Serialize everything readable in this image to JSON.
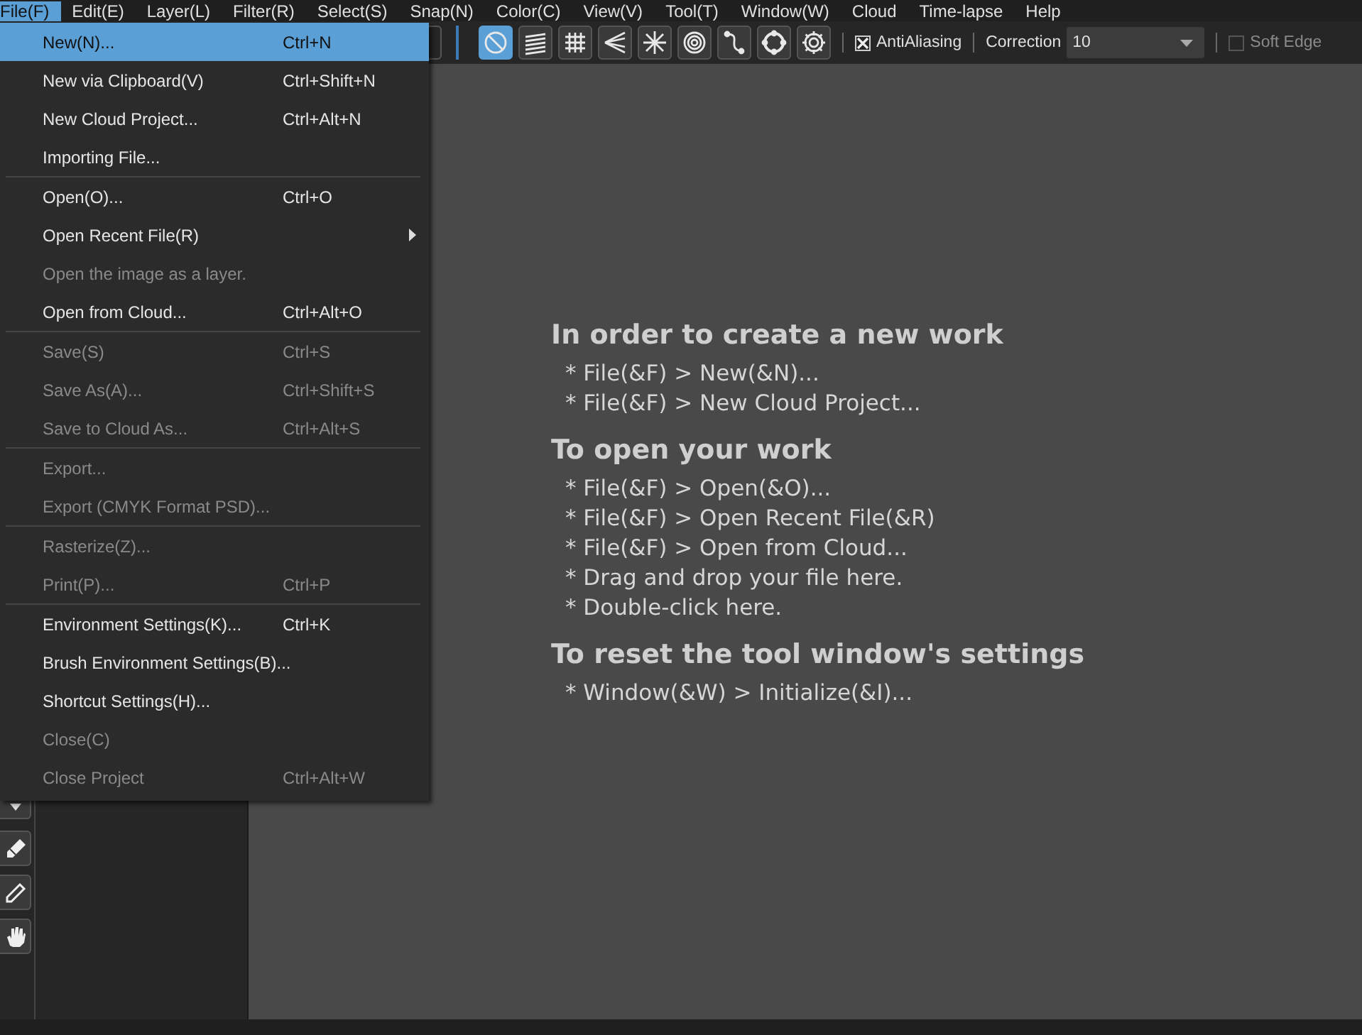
{
  "menubar": [
    {
      "label": "File(F)",
      "selected": true
    },
    {
      "label": "Edit(E)",
      "selected": false
    },
    {
      "label": "Layer(L)",
      "selected": false
    },
    {
      "label": "Filter(R)",
      "selected": false
    },
    {
      "label": "Select(S)",
      "selected": false
    },
    {
      "label": "Snap(N)",
      "selected": false
    },
    {
      "label": "Color(C)",
      "selected": false
    },
    {
      "label": "View(V)",
      "selected": false
    },
    {
      "label": "Tool(T)",
      "selected": false
    },
    {
      "label": "Window(W)",
      "selected": false
    },
    {
      "label": "Cloud",
      "selected": false
    },
    {
      "label": "Time-lapse",
      "selected": false
    },
    {
      "label": "Help",
      "selected": false
    }
  ],
  "toolbar": {
    "rulers": [
      {
        "kind": "none",
        "selected": true
      },
      {
        "kind": "parallel",
        "selected": false
      },
      {
        "kind": "grid",
        "selected": false
      },
      {
        "kind": "perspective",
        "selected": false
      },
      {
        "kind": "radial",
        "selected": false
      },
      {
        "kind": "concentric",
        "selected": false
      },
      {
        "kind": "curve",
        "selected": false
      },
      {
        "kind": "ellipse",
        "selected": false
      },
      {
        "kind": "settings",
        "selected": false
      }
    ],
    "antialiasing": {
      "label": "AntiAliasing",
      "checked": true
    },
    "correction": {
      "label": "Correction",
      "value": "10"
    },
    "soft_edge": {
      "label": "Soft Edge",
      "checked": false
    }
  },
  "file_menu": [
    [
      {
        "label": "New(N)...",
        "shortcut": "Ctrl+N",
        "disabled": false,
        "selected": true
      },
      {
        "label": "New via Clipboard(V)",
        "shortcut": "Ctrl+Shift+N",
        "disabled": false,
        "selected": false
      },
      {
        "label": "New Cloud Project...",
        "shortcut": "Ctrl+Alt+N",
        "disabled": false,
        "selected": false
      },
      {
        "label": "Importing File...",
        "disabled": false,
        "selected": false
      }
    ],
    [
      {
        "label": "Open(O)...",
        "shortcut": "Ctrl+O",
        "disabled": false,
        "selected": false
      },
      {
        "label": "Open Recent File(R)",
        "submenu": true,
        "disabled": false,
        "selected": false
      },
      {
        "label": "Open the image as a layer.",
        "disabled": true,
        "selected": false
      },
      {
        "label": "Open from Cloud...",
        "shortcut": "Ctrl+Alt+O",
        "disabled": false,
        "selected": false
      }
    ],
    [
      {
        "label": "Save(S)",
        "shortcut": "Ctrl+S",
        "disabled": true,
        "selected": false
      },
      {
        "label": "Save As(A)...",
        "shortcut": "Ctrl+Shift+S",
        "disabled": true,
        "selected": false
      },
      {
        "label": "Save to Cloud As...",
        "shortcut": "Ctrl+Alt+S",
        "disabled": true,
        "selected": false
      }
    ],
    [
      {
        "label": "Export...",
        "disabled": true,
        "selected": false
      },
      {
        "label": "Export (CMYK Format PSD)...",
        "disabled": true,
        "selected": false
      }
    ],
    [
      {
        "label": "Rasterize(Z)...",
        "disabled": true,
        "selected": false
      },
      {
        "label": "Print(P)...",
        "shortcut": "Ctrl+P",
        "disabled": true,
        "selected": false
      }
    ],
    [
      {
        "label": "Environment Settings(K)...",
        "shortcut": "Ctrl+K",
        "disabled": false,
        "selected": false
      },
      {
        "label": "Brush Environment Settings(B)...",
        "disabled": false,
        "selected": false
      },
      {
        "label": "Shortcut Settings(H)...",
        "disabled": false,
        "selected": false
      },
      {
        "label": "Close(C)",
        "disabled": true,
        "selected": false
      },
      {
        "label": "Close Project",
        "shortcut": "Ctrl+Alt+W",
        "disabled": true,
        "selected": false
      }
    ]
  ],
  "tools": [
    {
      "kind": "caret"
    },
    {
      "kind": "eraser"
    },
    {
      "kind": "dropper"
    },
    {
      "kind": "hand"
    }
  ],
  "canvas_help": [
    {
      "heading": "In order to create a new work",
      "lines": [
        "* File(&F) > New(&N)...",
        "* File(&F) > New Cloud Project..."
      ]
    },
    {
      "heading": "To open your work",
      "lines": [
        "* File(&F) > Open(&O)...",
        "* File(&F) > Open Recent File(&R)",
        "* File(&F) > Open from Cloud...",
        "* Drag and drop your file here.",
        "* Double-click here."
      ]
    },
    {
      "heading": "To reset the tool window's settings",
      "lines": [
        "* Window(&W) > Initialize(&I)..."
      ]
    }
  ]
}
